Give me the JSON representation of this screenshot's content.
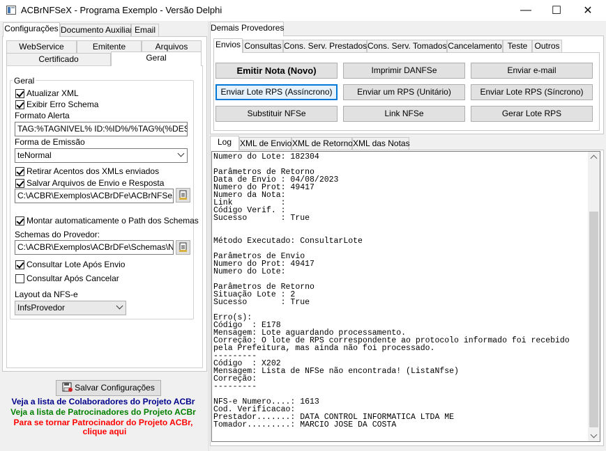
{
  "window": {
    "title": "ACBrNFSeX - Programa Exemplo - Versão Delphi",
    "minimize": "—",
    "maximize": "☐",
    "close": "✕"
  },
  "left": {
    "tabs": [
      "Configurações",
      "Documento Auxiliar",
      "Email"
    ],
    "subtabs_row1": [
      "WebService",
      "Emitente",
      "Arquivos"
    ],
    "subtabs_row2": [
      "Certificado",
      "Geral"
    ],
    "geral": {
      "group_title": "Geral",
      "atualizar_xml": "Atualizar XML",
      "exibir_erro_schema": "Exibir Erro Schema",
      "formato_alerta_label": "Formato Alerta",
      "formato_alerta_value": "TAG:%TAGNIVEL% ID:%ID%/%TAG%(%DESCRI",
      "forma_emissao_label": "Forma de Emissão",
      "forma_emissao_value": "teNormal",
      "retirar_acentos": "Retirar Acentos dos XMLs enviados",
      "salvar_arquivos": "Salvar Arquivos de Envio e Resposta",
      "path_arquivos": "C:\\ACBR\\Exemplos\\ACBrDFe\\ACBrNFSeX\\Delp",
      "montar_path": "Montar automaticamente o Path dos Schemas",
      "schemas_label": "Schemas do Provedor:",
      "schemas_path": "C:\\ACBR\\Exemplos\\ACBrDFe\\Schemas\\NFSe",
      "consultar_lote": "Consultar Lote Após Envio",
      "consultar_cancelar": "Consultar Após Cancelar",
      "layout_label": "Layout da NFS-e",
      "layout_value": "InfsProvedor"
    },
    "salvar_button": "Salvar Configurações",
    "links": {
      "colaboradores": "Veja a lista de Colaboradores do Projeto ACBr",
      "patrocinadores": "Veja a lista de Patrocinadores do Projeto ACBr",
      "tornar_1": "Para se tornar Patrocinador do Projeto ACBr,",
      "tornar_2": "clique aqui"
    },
    "colors": {
      "blue_link": "#00008b",
      "green_link": "#008000",
      "red_link": "#ff0000"
    }
  },
  "right": {
    "top_tab": "Demais Provedores",
    "tabs": [
      "Envios",
      "Consultas",
      "Cons. Serv. Prestados",
      "Cons. Serv. Tomados",
      "Cancelamento",
      "Teste",
      "Outros"
    ],
    "buttons": {
      "emitir_nota": "Emitir Nota (Novo)",
      "imprimir_danfse": "Imprimir DANFSe",
      "enviar_email": "Enviar e-mail",
      "enviar_lote_assincrono": "Enviar Lote RPS (Assíncrono)",
      "enviar_rps_unitario": "Enviar um RPS (Unitário)",
      "enviar_lote_sincrono": "Enviar Lote RPS (Síncrono)",
      "substituir_nfse": "Substituir NFSe",
      "link_nfse": "Link NFSe",
      "gerar_lote_rps": "Gerar Lote RPS"
    },
    "log_tabs": [
      "Log",
      "XML de Envio",
      "XML de Retorno",
      "XML das Notas"
    ],
    "log_text": "Numero do Lote: 182304\n\nParâmetros de Retorno\nData de Envio : 04/08/2023\nNumero do Prot: 49417\nNumero da Nota:\nLink          :\nCódigo Verif. :\nSucesso       : True\n\n\nMétodo Executado: ConsultarLote\n\nParâmetros de Envio\nNumero do Prot: 49417\nNumero do Lote:\n\nParâmetros de Retorno\nSituação Lote : 2\nSucesso       : True\n\nErro(s):\nCódigo  : E178\nMensagem: Lote aguardando processamento.\nCorreção: O lote de RPS correspondente ao protocolo informado foi recebido\npela Prefeitura, mas ainda não foi processado.\n---------\nCódigo  : X202\nMensagem: Lista de NFSe não encontrada! (ListaNfse)\nCorreção:\n---------\n\nNFS-e Numero....: 1613\nCod. Verificacao:\nPrestador.......: DATA CONTROL INFORMATICA LTDA ME\nTomador.........: MARCIO JOSE DA COSTA"
  }
}
